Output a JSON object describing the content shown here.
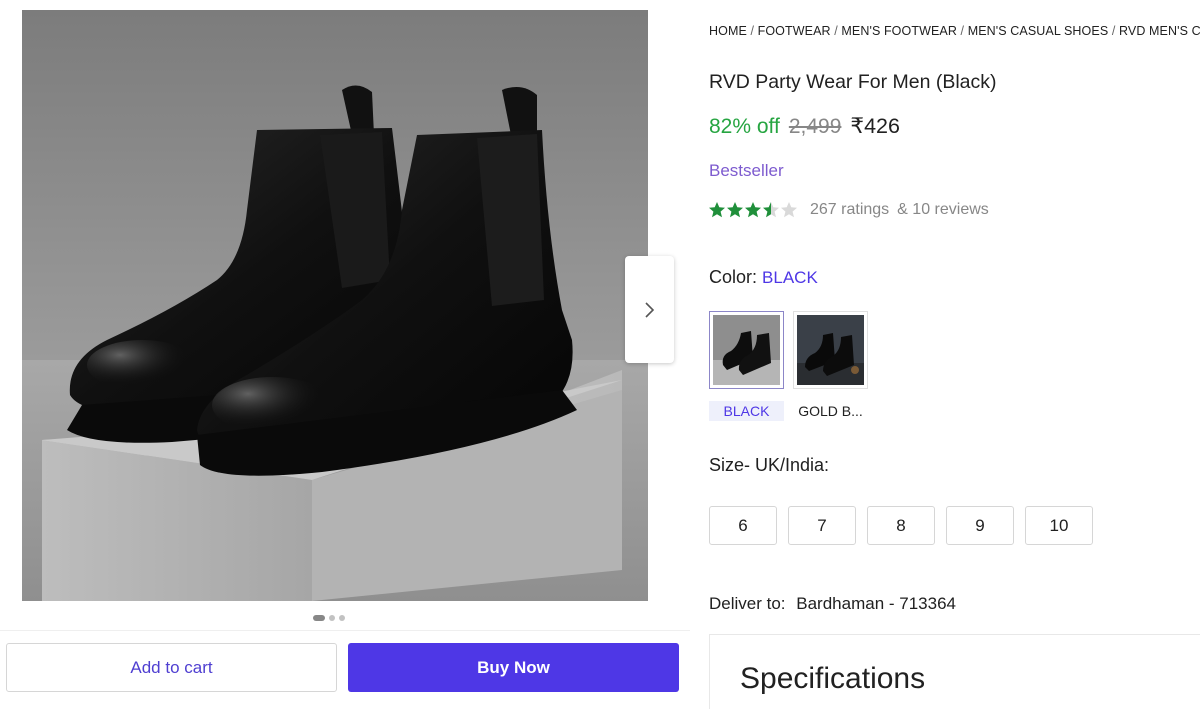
{
  "gallery": {
    "image_alt": "RVD Party Wear For Men (Black) product image",
    "next_icon": "chevron-right-icon",
    "dots_total": 3,
    "dots_active": 1
  },
  "actions": {
    "add_to_cart": "Add to cart",
    "buy_now": "Buy Now"
  },
  "breadcrumb": [
    "HOME",
    "FOOTWEAR",
    "MEN'S FOOTWEAR",
    "MEN'S CASUAL SHOES",
    "RVD MEN'S CASU"
  ],
  "product": {
    "title": "RVD Party Wear For Men (Black)",
    "discount": "82% off",
    "mrp": "2,499",
    "price": "₹426",
    "badge": "Bestseller",
    "rating_stars": 3.5,
    "ratings": "267 ratings",
    "reviews": "& 10 reviews"
  },
  "color": {
    "label": "Color:",
    "selected": "BLACK",
    "options": [
      {
        "label": "BLACK",
        "selected": true
      },
      {
        "label": "GOLD B...",
        "selected": false
      }
    ]
  },
  "size": {
    "label": "Size- UK/India:",
    "options": [
      "6",
      "7",
      "8",
      "9",
      "10"
    ]
  },
  "delivery": {
    "label": "Deliver to:",
    "location": "Bardhaman - 713364"
  },
  "specifications": {
    "title": "Specifications"
  },
  "colors": {
    "accent": "#4e37e6",
    "discount_green": "#26a541",
    "star_green": "#1f8f3a",
    "badge_purple": "#7d5bcf"
  }
}
